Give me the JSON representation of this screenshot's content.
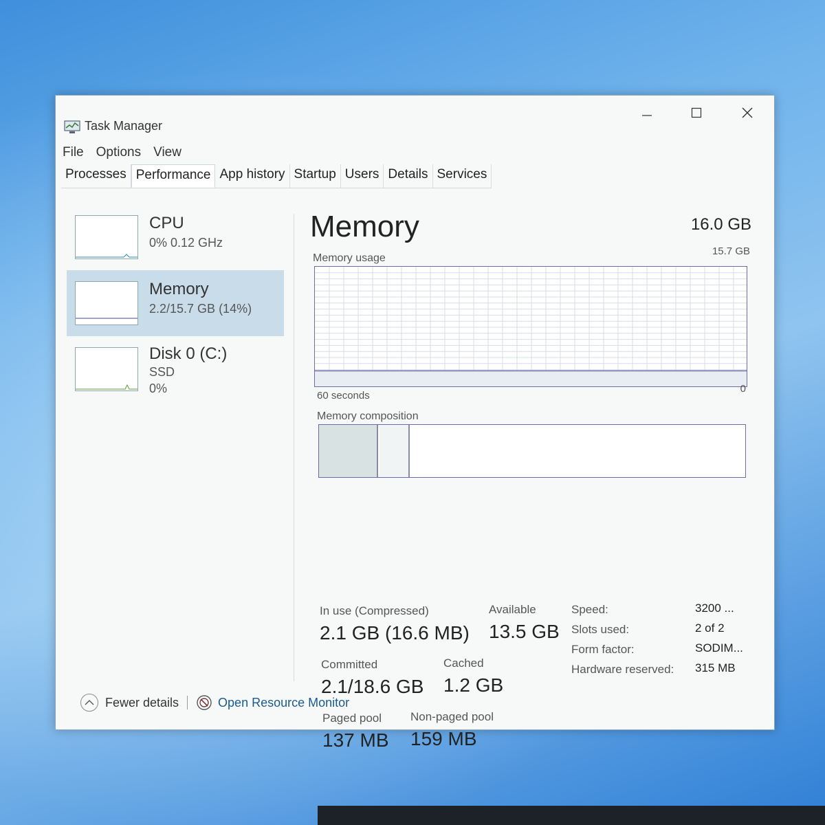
{
  "window": {
    "title": "Task Manager"
  },
  "menu": [
    "File",
    "Options",
    "View"
  ],
  "tabs": [
    {
      "label": "Processes",
      "active": false
    },
    {
      "label": "Performance",
      "active": true
    },
    {
      "label": "App history",
      "active": false
    },
    {
      "label": "Startup",
      "active": false
    },
    {
      "label": "Users",
      "active": false
    },
    {
      "label": "Details",
      "active": false
    },
    {
      "label": "Services",
      "active": false
    }
  ],
  "sidebar": {
    "cpu": {
      "name": "CPU",
      "sub": "0%  0.12 GHz"
    },
    "memory": {
      "name": "Memory",
      "sub": "2.2/15.7 GB (14%)"
    },
    "disk": {
      "name": "Disk 0 (C:)",
      "sub1": "SSD",
      "sub2": "0%"
    }
  },
  "main": {
    "title": "Memory",
    "total": "16.0 GB",
    "max": "15.7 GB",
    "usage_label": "Memory usage",
    "axis_left": "60 seconds",
    "axis_right": "0",
    "usage_level": 0.14,
    "composition_label": "Memory composition",
    "in_use": {
      "label": "In use (Compressed)",
      "value": "2.1 GB (16.6 MB)"
    },
    "available": {
      "label": "Available",
      "value": "13.5 GB"
    },
    "committed": {
      "label": "Committed",
      "value": "2.1/18.6 GB"
    },
    "cached": {
      "label": "Cached",
      "value": "1.2 GB"
    },
    "paged_pool": {
      "label": "Paged pool",
      "value": "137 MB"
    },
    "nonpaged_pool": {
      "label": "Non-paged pool",
      "value": "159 MB"
    },
    "specs": [
      {
        "key": "Speed:",
        "value": "3200 ..."
      },
      {
        "key": "Slots used:",
        "value": "2 of 2"
      },
      {
        "key": "Form factor:",
        "value": "SODIM..."
      },
      {
        "key": "Hardware reserved:",
        "value": "315 MB"
      }
    ]
  },
  "footer": {
    "fewer_details": "Fewer details",
    "open_resource_monitor": "Open Resource Monitor"
  },
  "colors": {
    "graph_line": "#6e6aa6",
    "selected": "#c9dcea",
    "link": "#1a5a8c"
  }
}
